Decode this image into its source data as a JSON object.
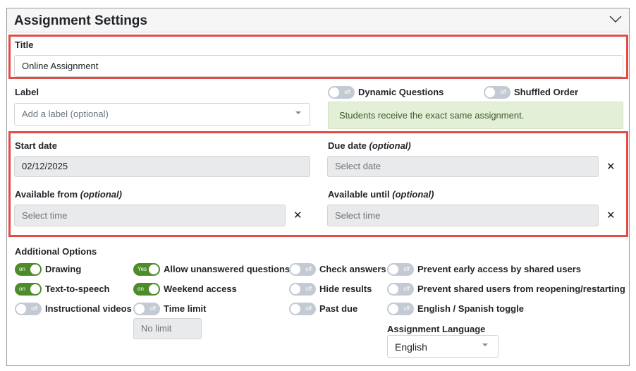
{
  "panel": {
    "title": "Assignment Settings"
  },
  "title_field": {
    "label": "Title",
    "value": "Online Assignment"
  },
  "label_field": {
    "label": "Label",
    "placeholder": "Add a label (optional)"
  },
  "dynamic_questions": {
    "state": "off",
    "label": "Dynamic Questions"
  },
  "shuffled_order": {
    "state": "off",
    "label": "Shuffled Order"
  },
  "info_message": "Students receive the exact same assignment.",
  "start_date": {
    "label": "Start date",
    "value": "02/12/2025"
  },
  "due_date": {
    "label": "Due date",
    "optional": "(optional)",
    "placeholder": "Select date"
  },
  "available_from": {
    "label": "Available from",
    "optional": "(optional)",
    "placeholder": "Select time"
  },
  "available_until": {
    "label": "Available until",
    "optional": "(optional)",
    "placeholder": "Select time"
  },
  "clear_symbol": "✕",
  "additional_options": {
    "heading": "Additional Options",
    "items": [
      {
        "label": "Drawing",
        "state": "on",
        "on": true
      },
      {
        "label": "Text-to-speech",
        "state": "on",
        "on": true
      },
      {
        "label": "Instructional videos",
        "state": "off",
        "on": false
      },
      {
        "label": "Allow unanswered questions",
        "state": "Yes",
        "on": true
      },
      {
        "label": "Weekend access",
        "state": "on",
        "on": true
      },
      {
        "label": "Time limit",
        "state": "off",
        "on": false
      },
      {
        "label": "Check answers",
        "state": "off",
        "on": false
      },
      {
        "label": "Hide results",
        "state": "off",
        "on": false
      },
      {
        "label": "Past due",
        "state": "off",
        "on": false
      },
      {
        "label": "Prevent early access by shared users",
        "state": "off",
        "on": false
      },
      {
        "label": "Prevent shared users from reopening/restarting",
        "state": "off",
        "on": false
      },
      {
        "label": "English / Spanish toggle",
        "state": "off",
        "on": false
      }
    ],
    "time_limit_value": "No limit",
    "assignment_language": {
      "label": "Assignment Language",
      "value": "English"
    }
  },
  "colors": {
    "toggle_on": "#4c8c2a",
    "toggle_off": "#c3cad4",
    "highlight": "#e24b46",
    "info_bg": "#e4efd8"
  }
}
